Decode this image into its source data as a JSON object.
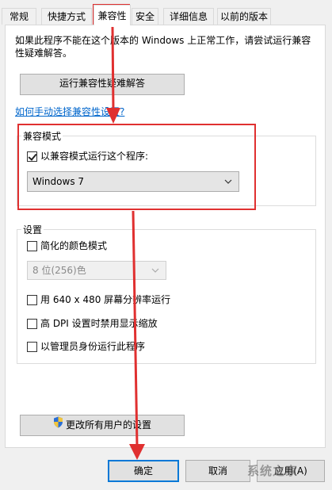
{
  "tabs": [
    {
      "label": "常规"
    },
    {
      "label": "快捷方式"
    },
    {
      "label": "兼容性"
    },
    {
      "label": "安全"
    },
    {
      "label": "详细信息"
    },
    {
      "label": "以前的版本"
    }
  ],
  "intro_text": "如果此程序不能在这个版本的 Windows 上正常工作，请尝试运行兼容性疑难解答。",
  "troubleshoot_button": "运行兼容性疑难解答",
  "manual_link": "如何手动选择兼容性设置?",
  "compat_mode": {
    "title": "兼容模式",
    "checkbox_label": "以兼容模式运行这个程序:",
    "checked": true,
    "selected_os": "Windows 7"
  },
  "settings": {
    "title": "设置",
    "reduced_color_label": "简化的颜色模式",
    "color_select_value": "8 位(256)色",
    "res_640_label": "用 640 x 480 屏幕分辨率运行",
    "high_dpi_label": "高 DPI 设置时禁用显示缩放",
    "run_admin_label": "以管理员身份运行此程序"
  },
  "change_all_button": "更改所有用户的设置",
  "footer": {
    "ok_button": "确定",
    "cancel_button": "取消",
    "apply_button": "应用(A)"
  },
  "watermark": "系统之家",
  "colors": {
    "annotation_red": "#e03030",
    "link_blue": "#0066cc",
    "focus_blue": "#0078d7"
  }
}
